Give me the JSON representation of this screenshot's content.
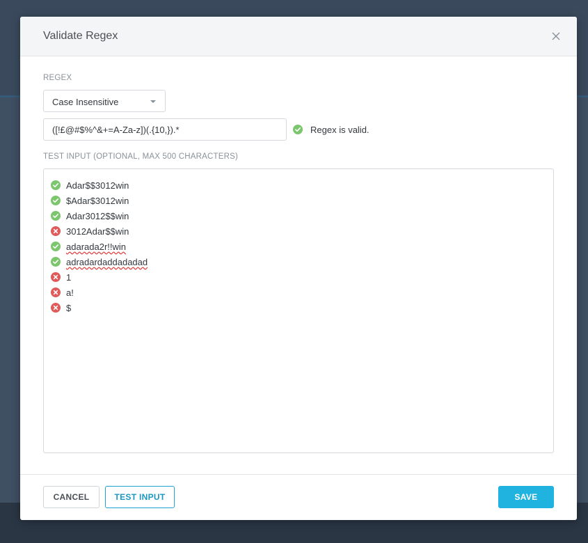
{
  "modal": {
    "title": "Validate Regex"
  },
  "regex": {
    "section_label": "REGEX",
    "mode_selected": "Case Insensitive",
    "pattern": "([!£@#$%^&+=A-Za-z])(.{10,}).*",
    "status_text": "Regex is valid.",
    "status": "valid"
  },
  "test_input": {
    "section_label": "TEST INPUT (OPTIONAL, MAX 500 CHARACTERS)",
    "lines": [
      {
        "text": "Adar$$3012win",
        "match": true,
        "spellcheck": false
      },
      {
        "text": "$Adar$3012win",
        "match": true,
        "spellcheck": false
      },
      {
        "text": "Adar3012$$win",
        "match": true,
        "spellcheck": false
      },
      {
        "text": "3012Adar$$win",
        "match": false,
        "spellcheck": false
      },
      {
        "text": "adarada2r!!win",
        "match": true,
        "spellcheck": true
      },
      {
        "text": "adradardaddadadad",
        "match": true,
        "spellcheck": true
      },
      {
        "text": "1",
        "match": false,
        "spellcheck": false
      },
      {
        "text": "a!",
        "match": false,
        "spellcheck": false
      },
      {
        "text": "$",
        "match": false,
        "spellcheck": false
      }
    ]
  },
  "footer": {
    "cancel_label": "CANCEL",
    "test_label": "TEST INPUT",
    "save_label": "SAVE"
  },
  "colors": {
    "valid": "#7cc66e",
    "invalid": "#e05a5a",
    "accent": "#20b3e0"
  }
}
